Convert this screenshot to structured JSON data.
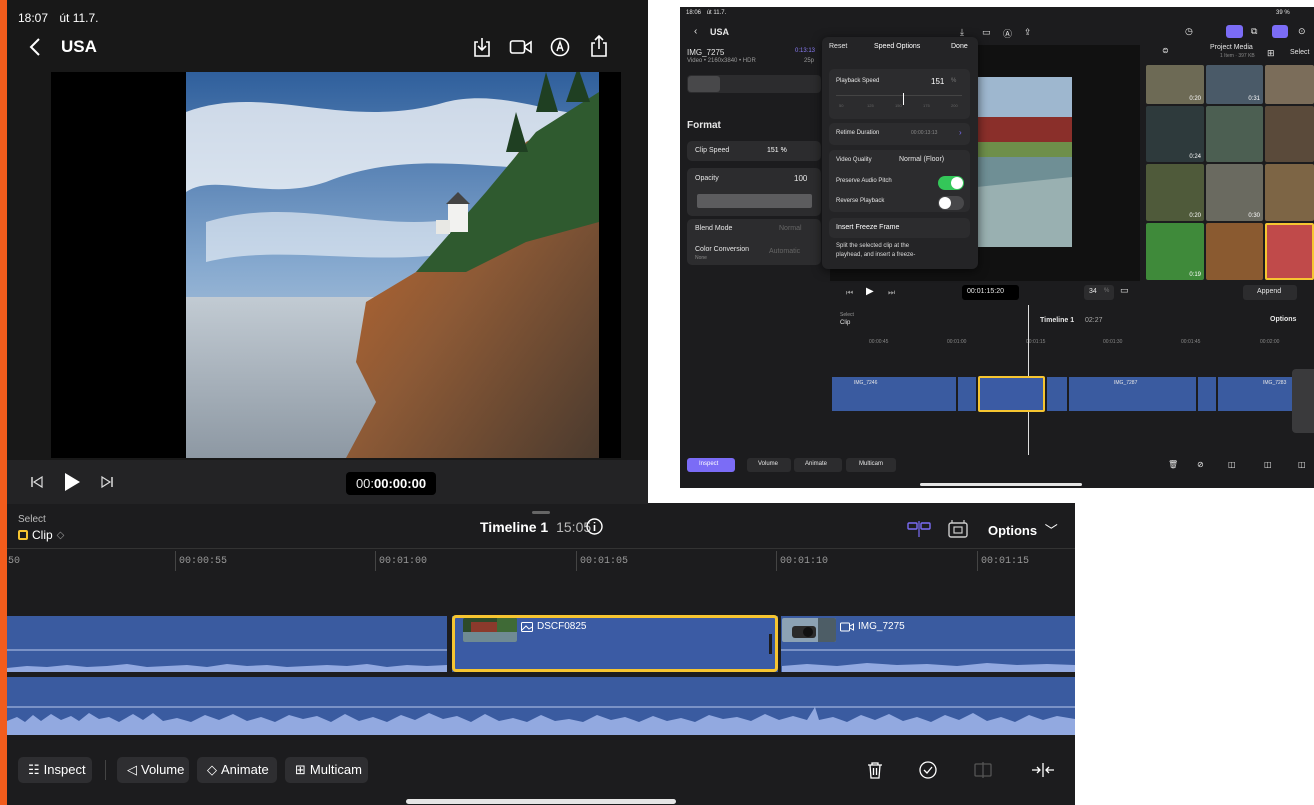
{
  "main": {
    "status_time": "18:07",
    "status_date": "út 11.7.",
    "nav_title": "USA",
    "timecode_prefix": "00:",
    "timecode_main": "00:00:00",
    "timeline": {
      "select_label": "Select",
      "clip_label": "Clip",
      "title": "Timeline 1",
      "duration": "15:05",
      "options_label": "Options",
      "ruler": [
        "50",
        "00:00:55",
        "00:01:00",
        "00:01:05",
        "00:01:10",
        "00:01:15"
      ],
      "clips": {
        "selected_name": "DSCF0825",
        "right_name": "IMG_7275"
      }
    },
    "tools": {
      "inspect": "Inspect",
      "volume": "Volume",
      "animate": "Animate",
      "multicam": "Multicam"
    }
  },
  "inset": {
    "status_time": "18:06",
    "status_date": "út 11.7.",
    "status_right": "39 %",
    "nav_title": "USA",
    "clip_title": "IMG_7275",
    "clip_meta": "Video • 2160x3840 • HDR",
    "clip_duration": "0:13:13",
    "clip_fps": "25p",
    "inspector": {
      "section": "Format",
      "clip_speed_label": "Clip Speed",
      "clip_speed_value": "151 %",
      "opacity_label": "Opacity",
      "opacity_value": "100",
      "blend_mode_label": "Blend Mode",
      "blend_mode_value": "Normal",
      "color_conversion_label": "Color Conversion",
      "color_conversion_sub": "None",
      "color_conversion_value": "Automatic"
    },
    "speed_popover": {
      "reset": "Reset",
      "title": "Speed Options",
      "done": "Done",
      "playback_speed_label": "Playback Speed",
      "playback_speed_value": "151",
      "playback_speed_unit": "%",
      "scale": [
        "50",
        "125",
        "150",
        "175",
        "200"
      ],
      "retime_label": "Retime Duration",
      "retime_value": "00:00:13:13",
      "video_quality_label": "Video Quality",
      "video_quality_value": "Normal (Floor)",
      "preserve_audio_label": "Preserve Audio Pitch",
      "reverse_label": "Reverse Playback",
      "freeze_label": "Insert Freeze Frame",
      "freeze_desc_1": "Split the selected clip at the",
      "freeze_desc_2": "playhead, and insert a freeze-"
    },
    "media": {
      "title": "Project Media",
      "subtitle": "1 Item · 397 KB",
      "select_label": "Select",
      "append_label": "Append",
      "thumb_durations": [
        "0:20",
        "0:31",
        "0:24",
        "0:20",
        "0:30",
        "0:19"
      ]
    },
    "transport": {
      "timecode": "00:01:15:20",
      "zoom_value": "34",
      "zoom_unit": "%"
    },
    "timeline": {
      "select_label": "Select",
      "clip_label": "Clip",
      "title": "Timeline 1",
      "duration": "02:27",
      "options_label": "Options",
      "ruler": [
        "00:00:45",
        "00:01:00",
        "00:01:15",
        "00:01:30",
        "00:01:45",
        "00:02:00"
      ],
      "clip_names": [
        "IMG_7246",
        "IMG_7287",
        "IMG_7283"
      ]
    },
    "tools": {
      "inspect": "Inspect",
      "volume": "Volume",
      "animate": "Animate",
      "multicam": "Multicam"
    },
    "colors": {
      "accent": "#7b6cf6",
      "toggle_on": "#34c759",
      "clip_blue": "#3a5ba0",
      "selection_yellow": "#f6c531"
    }
  }
}
